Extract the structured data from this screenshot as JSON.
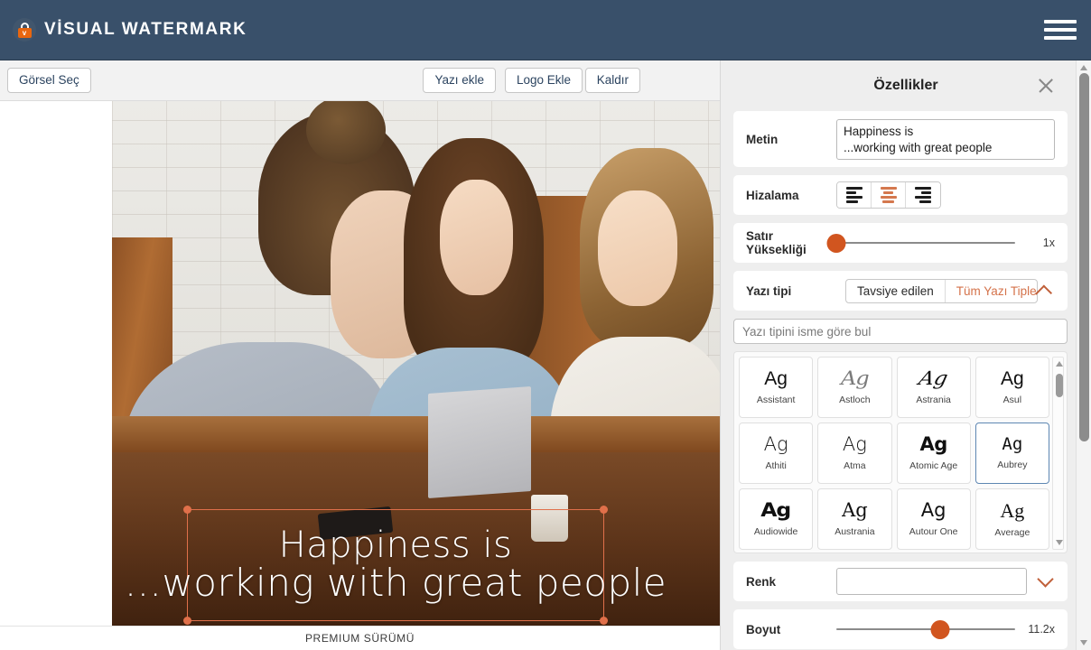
{
  "header": {
    "brand_title": "VİSUAL WATERMARK",
    "lock_letter": "v",
    "menu_icon": "hamburger-menu-icon"
  },
  "toolbar": {
    "select_image": "Görsel Seç",
    "add_text": "Yazı ekle",
    "add_logo": "Logo Ekle",
    "remove": "Kaldır"
  },
  "canvas": {
    "watermark": {
      "line1": "Happiness is",
      "line2": "...working with great people"
    },
    "status": "PREMIUM SÜRÜMÜ"
  },
  "panel": {
    "title": "Özellikler",
    "close_icon": "close-icon",
    "text_row": {
      "label": "Metin",
      "value": "Happiness is\n...working with great people"
    },
    "align_row": {
      "label": "Hizalama",
      "options": [
        "align-left",
        "align-center",
        "align-right"
      ],
      "selected": "align-center"
    },
    "line_height_row": {
      "label": "Satır Yüksekliği",
      "value": "1x",
      "percent": 0
    },
    "font_row": {
      "label": "Yazı tipi",
      "tabs": [
        "Tavsiye edilen",
        "Tüm Yazı Tipleri"
      ],
      "selected_tab": "Tüm Yazı Tipleri",
      "collapse_icon": "chevron-up-icon",
      "search_placeholder": "Yazı tipini isme göre bul",
      "search_value": "",
      "fonts": [
        {
          "name": "Assistant",
          "sample": "Ag",
          "class": "fs-assistant",
          "selected": false
        },
        {
          "name": "Astloch",
          "sample": "Ag",
          "class": "fs-astloch",
          "selected": false
        },
        {
          "name": "Astrania",
          "sample": "Ag",
          "class": "fs-astrania",
          "selected": false
        },
        {
          "name": "Asul",
          "sample": "Ag",
          "class": "fs-asul",
          "selected": false
        },
        {
          "name": "Athiti",
          "sample": "Ag",
          "class": "fs-athiti",
          "selected": false
        },
        {
          "name": "Atma",
          "sample": "Ag",
          "class": "fs-atma",
          "selected": false
        },
        {
          "name": "Atomic Age",
          "sample": "Ag",
          "class": "fs-atomicage",
          "selected": false
        },
        {
          "name": "Aubrey",
          "sample": "Ag",
          "class": "fs-aubrey",
          "selected": true
        },
        {
          "name": "Audiowide",
          "sample": "Ag",
          "class": "fs-audiowide",
          "selected": false
        },
        {
          "name": "Austrania",
          "sample": "Ag",
          "class": "fs-austrania",
          "selected": false
        },
        {
          "name": "Autour One",
          "sample": "Ag",
          "class": "fs-autourone",
          "selected": false
        },
        {
          "name": "Average",
          "sample": "Ag",
          "class": "fs-average",
          "selected": false
        }
      ]
    },
    "color_row": {
      "label": "Renk",
      "value": "#ffffff",
      "expand_icon": "chevron-down-icon"
    },
    "size_row": {
      "label": "Boyut",
      "value": "11.2x",
      "percent": 58
    }
  },
  "colors": {
    "header_bg": "#39506a",
    "accent_orange": "#d1551f",
    "accent_soft": "#d4784e",
    "selection_blue": "#5e87b3",
    "panel_bg": "#eeeeee",
    "button_text": "#2c4460"
  }
}
